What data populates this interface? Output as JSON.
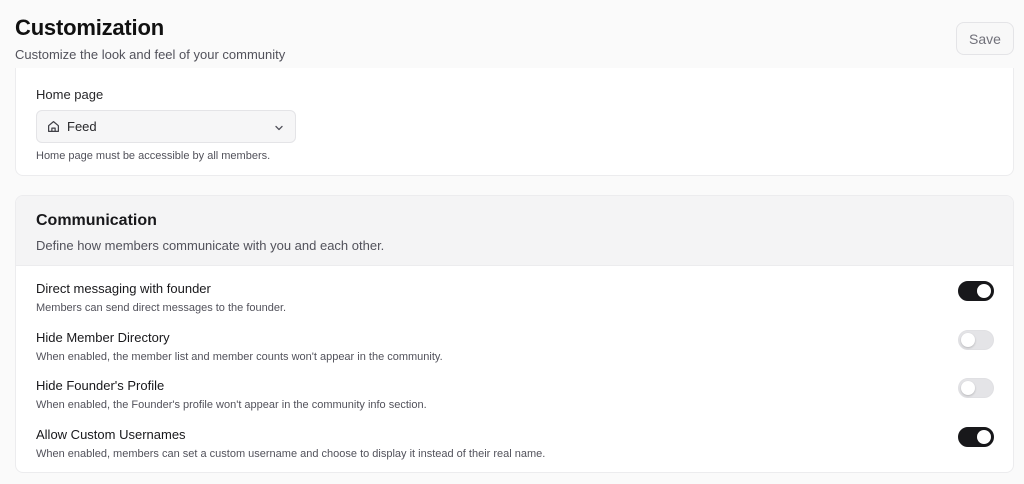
{
  "header": {
    "title": "Customization",
    "subtitle": "Customize the look and feel of your community",
    "save_label": "Save"
  },
  "home_page": {
    "label": "Home page",
    "selected": "Feed",
    "selected_icon": "home-icon",
    "help": "Home page must be accessible by all members."
  },
  "communication": {
    "title": "Communication",
    "description": "Define how members communicate with you and each other.",
    "settings": [
      {
        "title": "Direct messaging with founder",
        "description": "Members can send direct messages to the founder.",
        "enabled": true
      },
      {
        "title": "Hide Member Directory",
        "description": "When enabled, the member list and member counts won't appear in the community.",
        "enabled": false
      },
      {
        "title": "Hide Founder's Profile",
        "description": "When enabled, the Founder's profile won't appear in the community info section.",
        "enabled": false
      },
      {
        "title": "Allow Custom Usernames",
        "description": "When enabled, members can set a custom username and choose to display it instead of their real name.",
        "enabled": true
      }
    ]
  },
  "colors": {
    "toggle_on": "#18181b",
    "toggle_off": "#e4e4e7"
  }
}
